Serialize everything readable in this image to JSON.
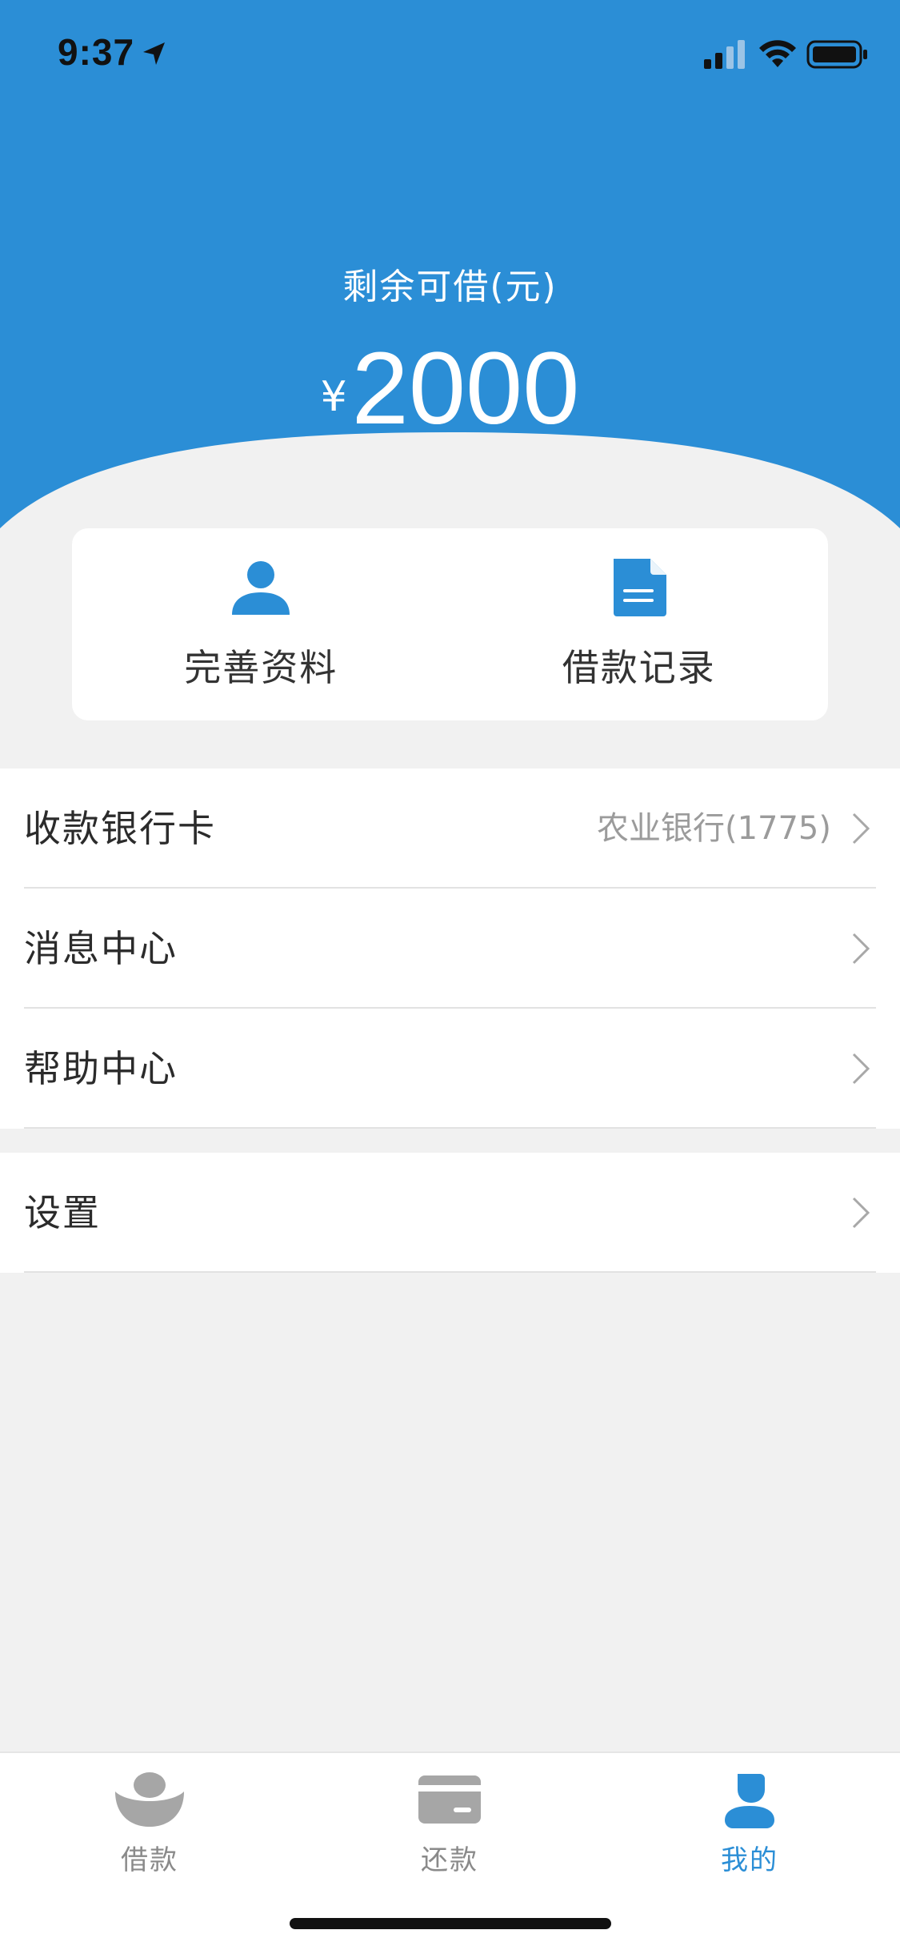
{
  "status_bar": {
    "time": "9:37"
  },
  "colors": {
    "primary": "#2b8ed6",
    "background": "#f1f1f1",
    "muted": "#9b9b9b",
    "tab_inactive": "#8a8a8a"
  },
  "balance": {
    "label": "剩余可借(元)",
    "currency": "¥",
    "amount": "2000"
  },
  "quick_actions": [
    {
      "label": "完善资料",
      "icon": "person-icon"
    },
    {
      "label": "借款记录",
      "icon": "document-icon"
    }
  ],
  "menu": {
    "bank_card": {
      "label": "收款银行卡",
      "value": "农业银行(1775)"
    },
    "messages": {
      "label": "消息中心"
    },
    "help": {
      "label": "帮助中心"
    },
    "settings": {
      "label": "设置"
    }
  },
  "tabs": [
    {
      "label": "借款",
      "icon": "ingot-icon",
      "active": false
    },
    {
      "label": "还款",
      "icon": "card-icon",
      "active": false
    },
    {
      "label": "我的",
      "icon": "user-icon",
      "active": true
    }
  ]
}
